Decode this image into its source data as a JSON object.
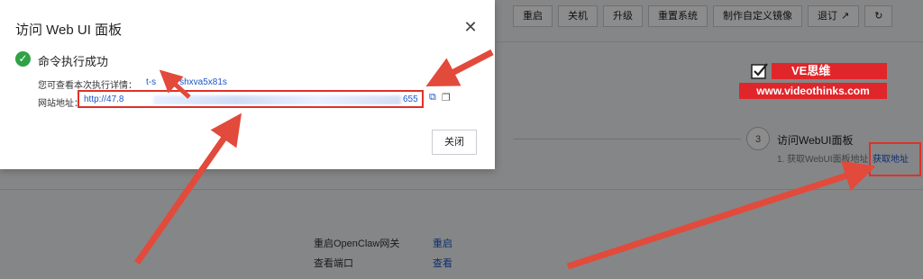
{
  "toolbar": {
    "buttons": [
      "重启",
      "关机",
      "升级",
      "重置系统",
      "制作自定义镜像",
      "退订"
    ],
    "external_icon": "external-link-icon",
    "refresh_icon": "refresh-icon"
  },
  "step": {
    "number": "3",
    "title": "访问WebUI面板",
    "desc": "1. 获取WebUI面板地址",
    "link": "获取地址"
  },
  "rows": [
    {
      "label": "重启OpenClaw网关",
      "action": "重启"
    },
    {
      "label": "查看端口",
      "action": "查看"
    }
  ],
  "modal": {
    "title": "访问 Web UI 面板",
    "success_text": "命令执行成功",
    "detail_label": "您可查看本次执行详情：",
    "detail_link": "t-s",
    "detail_link_suffix": "shxva5x81s",
    "url_label": "网站地址：",
    "url_prefix": "http://47.8",
    "url_suffix": "655",
    "close_label": "关闭"
  },
  "watermark": {
    "title": "VE思维",
    "url": "www.videothinks.com"
  },
  "colors": {
    "accent": "#1a55c9",
    "success": "#2fa246",
    "annotation": "#e0302a"
  }
}
